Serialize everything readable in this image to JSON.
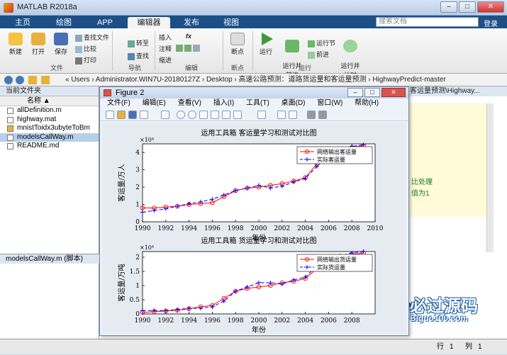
{
  "window": {
    "title": "MATLAB R2018a"
  },
  "tabs": [
    {
      "label": "主页"
    },
    {
      "label": "绘图"
    },
    {
      "label": "APP"
    },
    {
      "label": "编辑器"
    },
    {
      "label": "发布"
    },
    {
      "label": "视图"
    }
  ],
  "search": {
    "placeholder": "搜索文档"
  },
  "login_label": "登录",
  "toolbar": {
    "new_label": "新建",
    "open_label": "打开",
    "save_label": "保存",
    "find_files": "查找文件",
    "compare": "比较",
    "print": "打印",
    "file_group": "文件",
    "insert": "插入",
    "fx": "fx",
    "goto": "转至",
    "find": "查找",
    "comment": "注释",
    "indent": "缩进",
    "nav_group": "导航",
    "edit_group": "编辑",
    "breakpoint": "断点",
    "bp_group": "断点",
    "run": "运行",
    "run_advance": "运行并\n前进",
    "run_section": "运行节",
    "advance": "前进",
    "run_time": "运行并\n计时",
    "run_group": "运行"
  },
  "address": {
    "path": "«  Users  ›  Administrator.WIN7U-20180127Z  ›  Desktop  ›  高速公路预测：道路货运量和客运量预测  ›  HighwayPredict-master"
  },
  "file_panel": {
    "title": "当前文件夹",
    "column": "名称 ▲",
    "files": [
      {
        "name": "allDefinition.m"
      },
      {
        "name": "highway.mat"
      },
      {
        "name": "mnistToidx3ubyteToBm"
      },
      {
        "name": "modelsCallWay.m"
      },
      {
        "name": "README.md"
      }
    ],
    "details": "modelsCallWay.m  (脚本)"
  },
  "editor": {
    "header": "客运量预测\\Highway...",
    "note1": "比处理",
    "note2": "值为1"
  },
  "status": {
    "row_label": "行",
    "row": "1",
    "col_label": "列",
    "col": "1"
  },
  "figure": {
    "title": "Figure 2",
    "menu": [
      "文件(F)",
      "编辑(E)",
      "查看(V)",
      "插入(I)",
      "工具(T)",
      "桌面(D)",
      "窗口(W)",
      "帮助(H)"
    ]
  },
  "watermark": {
    "main": "必过源码",
    "sub": "Biguo100.com"
  },
  "chart_data": [
    {
      "type": "line",
      "title": "运用工具箱 客运量学习和测试对比图",
      "xlabel": "年份",
      "ylabel": "客运量/万人",
      "multiplier": "×10⁴",
      "xlim": [
        1990,
        2010
      ],
      "ylim": [
        0,
        4.5
      ],
      "xticks": [
        1990,
        1992,
        1994,
        1996,
        1998,
        2000,
        2002,
        2004,
        2006,
        2008,
        2010
      ],
      "yticks": [
        0,
        1,
        2,
        3,
        4
      ],
      "legend_position": "top-right",
      "x": [
        1990,
        1991,
        1992,
        1993,
        1994,
        1995,
        1996,
        1997,
        1998,
        1999,
        2000,
        2001,
        2002,
        2003,
        2004,
        2005,
        2006,
        2007,
        2008,
        2009
      ],
      "series": [
        {
          "name": "网络输出客运量",
          "color": "#ff0000",
          "marker": "circle",
          "values": [
            0.8,
            0.8,
            0.85,
            0.9,
            1.0,
            1.05,
            1.1,
            1.45,
            1.8,
            1.95,
            2.0,
            2.1,
            2.2,
            2.35,
            2.55,
            3.35,
            3.7,
            4.0,
            4.3,
            4.4
          ]
        },
        {
          "name": "实际客运量",
          "color": "#0000ff",
          "marker": "plus",
          "values": [
            0.55,
            0.65,
            0.75,
            0.9,
            1.05,
            1.15,
            1.3,
            1.55,
            1.8,
            1.95,
            2.1,
            1.95,
            2.05,
            2.3,
            2.5,
            3.2,
            3.8,
            4.1,
            4.35,
            4.45
          ]
        }
      ]
    },
    {
      "type": "line",
      "title": "运用工具箱 货运量学习和测试对比图",
      "xlabel": "年份",
      "ylabel": "客运量/万吨",
      "multiplier": "×10⁴",
      "xlim": [
        1990,
        2010
      ],
      "ylim": [
        0,
        2.2
      ],
      "xticks": [
        1990,
        1992,
        1994,
        1996,
        1998,
        2000,
        2002,
        2004,
        2006,
        2008
      ],
      "yticks": [
        0,
        0.5,
        1,
        1.5,
        2
      ],
      "legend_position": "top-right",
      "x": [
        1990,
        1991,
        1992,
        1993,
        1994,
        1995,
        1996,
        1997,
        1998,
        1999,
        2000,
        2001,
        2002,
        2003,
        2004,
        2005,
        2006,
        2007,
        2008,
        2009
      ],
      "series": [
        {
          "name": "网络输出货运量",
          "color": "#ff0000",
          "marker": "circle",
          "values": [
            0.05,
            0.08,
            0.1,
            0.13,
            0.18,
            0.25,
            0.3,
            0.55,
            0.8,
            0.9,
            0.95,
            1.0,
            1.1,
            1.15,
            1.25,
            1.6,
            1.85,
            2.0,
            2.1,
            2.15
          ]
        },
        {
          "name": "实际货运量",
          "color": "#0000ff",
          "marker": "plus",
          "values": [
            0.12,
            0.12,
            0.12,
            0.15,
            0.2,
            0.2,
            0.25,
            0.45,
            0.8,
            0.95,
            1.1,
            1.1,
            1.05,
            1.2,
            1.3,
            1.7,
            1.9,
            2.05,
            2.15,
            2.2
          ]
        }
      ]
    }
  ]
}
